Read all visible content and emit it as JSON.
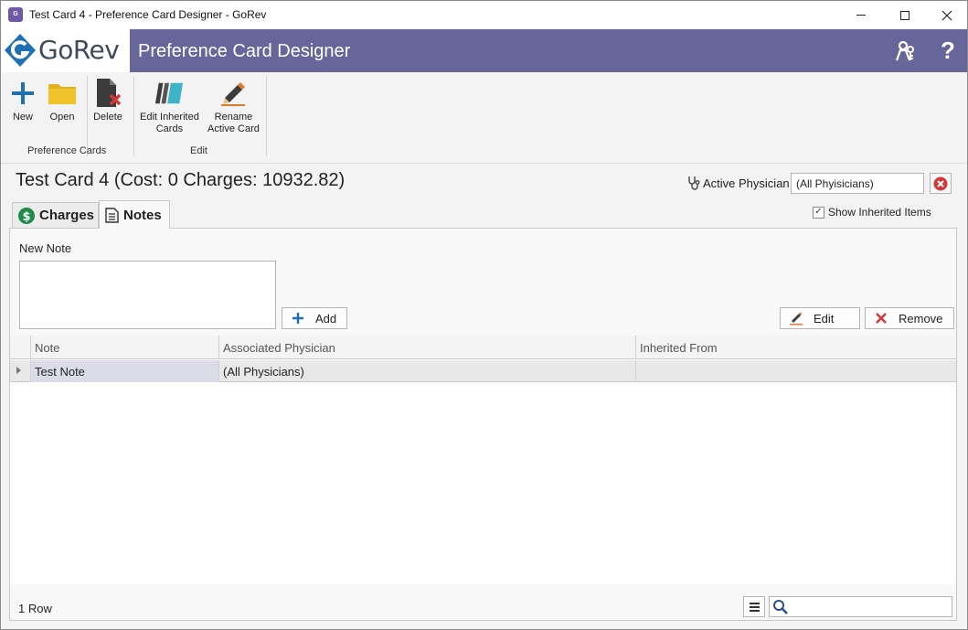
{
  "window": {
    "title": "Test Card 4 - Preference Card Designer - GoRev",
    "app_icon_text": "GoRev"
  },
  "header": {
    "logo_text": "GoRev",
    "title": "Preference Card Designer",
    "users_icon": "users-key-icon",
    "help_icon": "?"
  },
  "ribbon": {
    "groups": [
      {
        "label": "Preference Cards"
      },
      {
        "label": "Edit"
      }
    ],
    "new_label": "New",
    "open_label": "Open",
    "delete_label": "Delete",
    "edit_inherited_label_1": "Edit Inherited",
    "edit_inherited_label_2": "Cards",
    "rename_label_1": "Rename",
    "rename_label_2": "Active Card"
  },
  "card": {
    "title": "Test Card 4 (Cost: 0 Charges: 10932.82)",
    "active_physician_label": "Active Physician",
    "active_physician_value": "(All Phyisicians)"
  },
  "tabs": [
    {
      "label": "Charges",
      "icon": "dollar-icon",
      "active": false
    },
    {
      "label": "Notes",
      "icon": "document-icon",
      "active": true
    }
  ],
  "show_inherited": {
    "label": "Show Inherited Items",
    "checked": true
  },
  "notes": {
    "new_note_label": "New Note",
    "new_note_value": "",
    "add_label": "Add",
    "edit_label": "Edit",
    "remove_label": "Remove"
  },
  "grid": {
    "columns": [
      "Note",
      "Associated Physician",
      "Inherited From"
    ],
    "rows": [
      [
        "Test Note",
        "(All Physicians)",
        ""
      ]
    ],
    "row_count": "1 Row",
    "search_value": ""
  },
  "colors": {
    "header_bg": "#66669b",
    "accent_blue": "#1f6fb5",
    "remove_red": "#d23a3a",
    "folder_yellow": "#e3b220"
  }
}
